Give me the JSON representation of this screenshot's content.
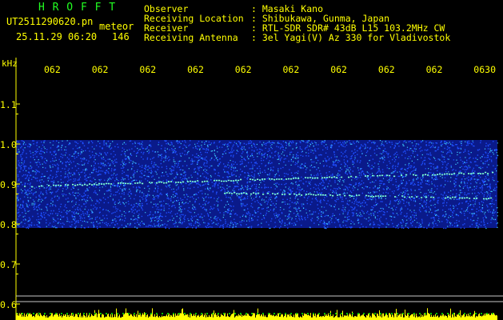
{
  "header": {
    "program": "H R O F F T",
    "filename": "UT2511290620.pn",
    "mode": "meteor",
    "datetime": "25.11.29 06:20",
    "count": "146",
    "info_labels": [
      "Observer",
      "Receiving Location",
      "Receiver",
      "Receiving Antenna"
    ],
    "info_values": [
      ": Masaki Kano",
      ": Shibukawa, Gunma, Japan",
      ": RTL-SDR SDR# 43dB L15 103.2MHz CW",
      ": 3el Yagi(V) Az 330 for Vladivostok"
    ]
  },
  "chart_data": {
    "type": "heatmap",
    "title": "",
    "yunit": "kHz",
    "x_tick_labels": [
      "062",
      "062",
      "062",
      "062",
      "062",
      "062",
      "062",
      "062",
      "062",
      "0630"
    ],
    "y_tick_labels": [
      "1.1",
      "1.0",
      "0.9",
      "0.8",
      "0.7",
      "0.6"
    ],
    "y_ticks": [
      1.1,
      1.0,
      0.9,
      0.8,
      0.7,
      0.6
    ],
    "ylim": [
      0.58,
      1.14
    ],
    "noise_band_khz": [
      0.79,
      1.01
    ],
    "traces": [
      {
        "name": "",
        "from_khz": 0.895,
        "to_khz": 0.93
      },
      {
        "name": "",
        "from_khz": 0.89,
        "to_khz": 0.865
      }
    ],
    "colors": {
      "background": "#000000",
      "noise_dark": "#0a1a8a",
      "noise_mid": "#1f4fff",
      "noise_bright": "#3fd0ff",
      "trace": "#7fffd0",
      "axis": "#ffff00",
      "baseline": "#c8c8c8"
    }
  }
}
